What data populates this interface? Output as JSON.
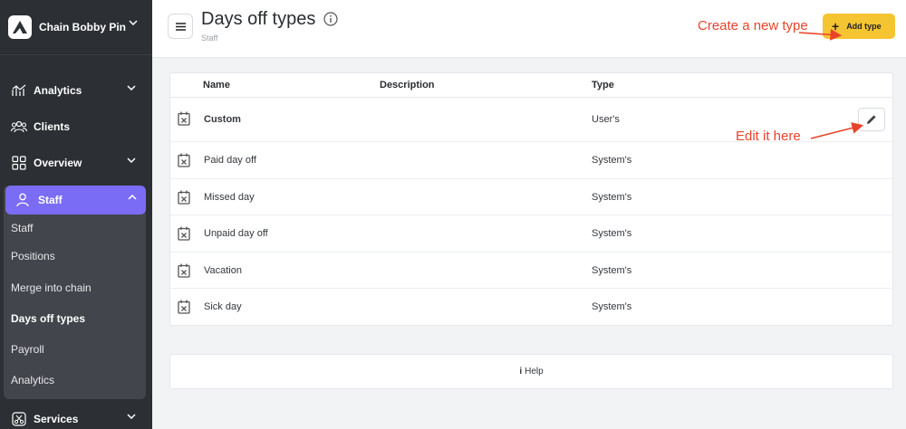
{
  "brand": {
    "name": "Chain Bobby Pin",
    "logo_icon": "brand-logo-icon"
  },
  "nav": {
    "analytics": "Analytics",
    "clients": "Clients",
    "overview": "Overview",
    "staff": "Staff",
    "services": "Services",
    "staff_sub": [
      "Staff",
      "Positions",
      "Merge into chain",
      "Days off types",
      "Payroll",
      "Analytics"
    ],
    "active_sub": "Days off types"
  },
  "header": {
    "title": "Days off types",
    "breadcrumb": "Staff",
    "add_label": "Add type",
    "add_plus": "+",
    "annotation_create": "Create a new type",
    "annotation_edit": "Edit it here"
  },
  "table": {
    "columns": [
      "Name",
      "Description",
      "Type"
    ],
    "rows": [
      {
        "name": "Custom",
        "description": "",
        "type": "User's"
      },
      {
        "name": "Paid day off",
        "description": "",
        "type": "System's"
      },
      {
        "name": "Missed day",
        "description": "",
        "type": "System's"
      },
      {
        "name": "Unpaid day off",
        "description": "",
        "type": "System's"
      },
      {
        "name": "Vacation",
        "description": "",
        "type": "System's"
      },
      {
        "name": "Sick day",
        "description": "",
        "type": "System's"
      }
    ]
  },
  "help": {
    "icon": "i",
    "label": "Help"
  },
  "colors": {
    "sidebar": "#2c2f33",
    "active": "#7b6cf6",
    "accent": "#f5c431",
    "annotation": "#e8442b"
  }
}
